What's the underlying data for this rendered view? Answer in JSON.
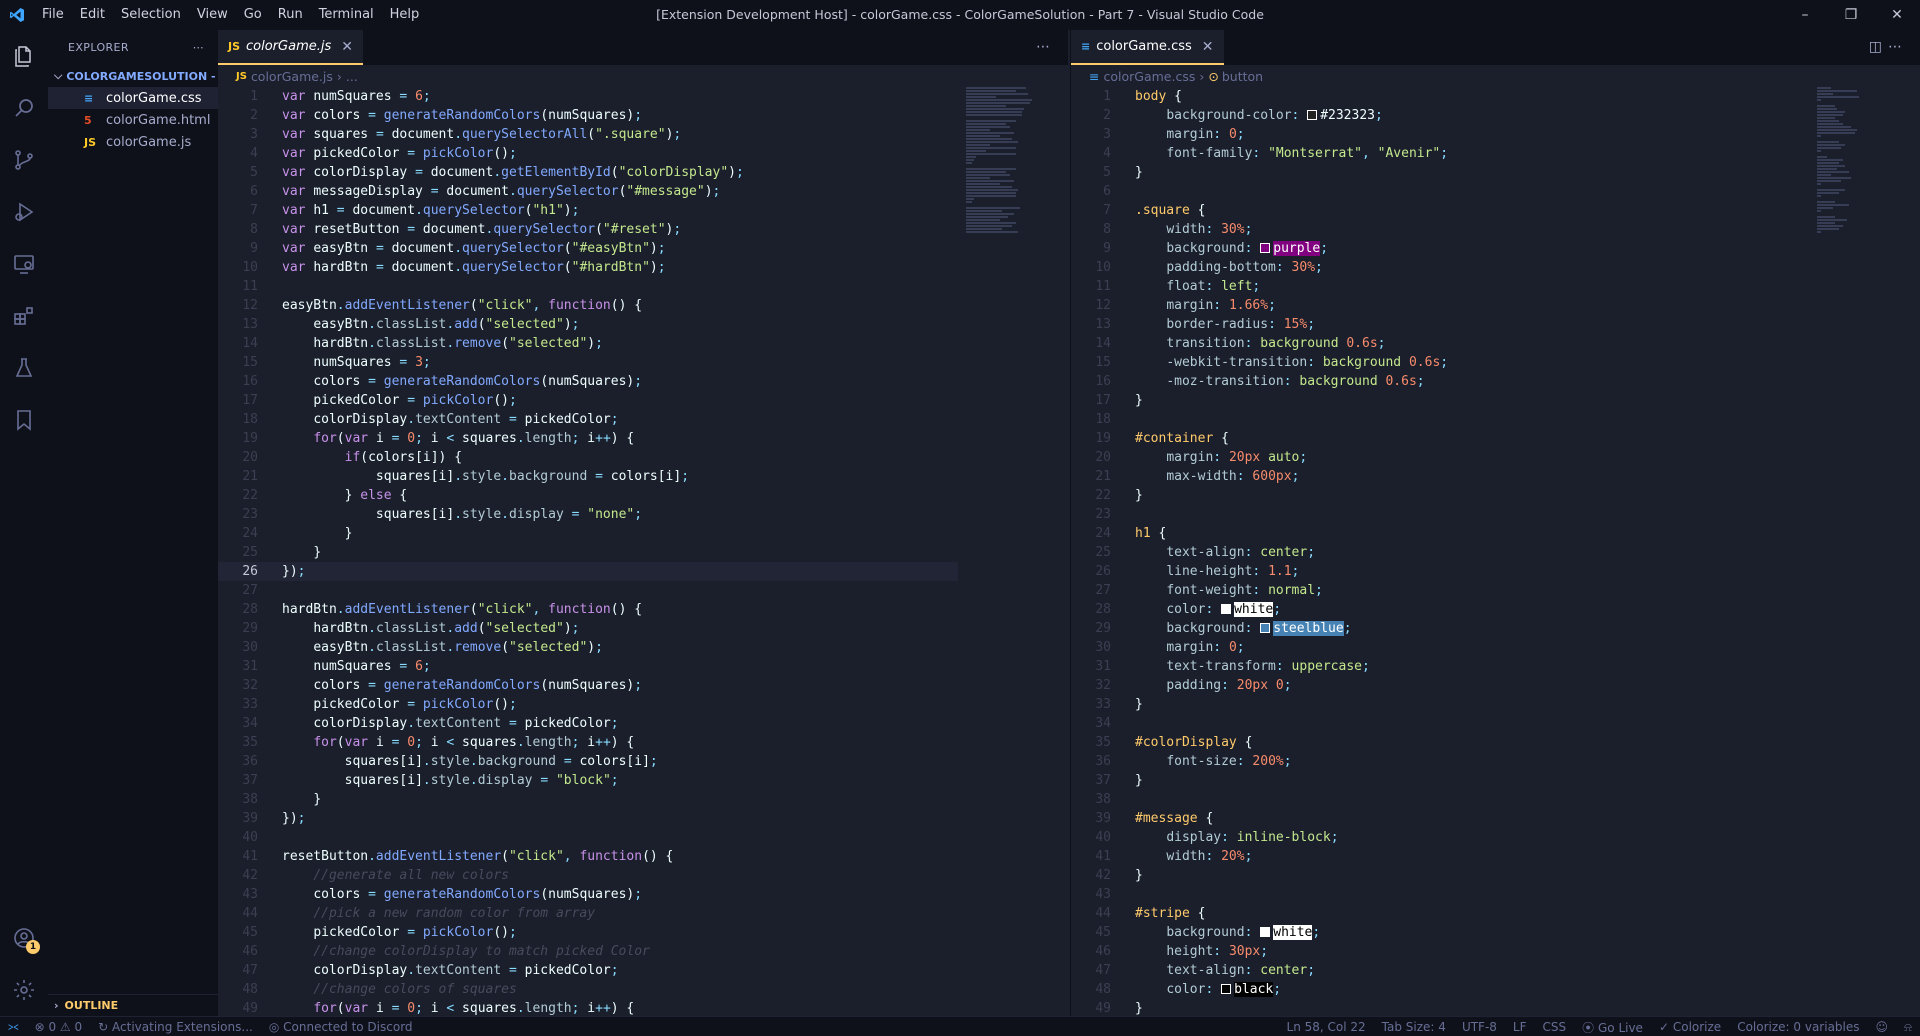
{
  "window": {
    "title": "[Extension Development Host] - colorGame.css - ColorGameSolution - Part 7 - Visual Studio Code",
    "menu": [
      "File",
      "Edit",
      "Selection",
      "View",
      "Go",
      "Run",
      "Terminal",
      "Help"
    ]
  },
  "sidebar": {
    "title": "EXPLORER",
    "folder": "COLORGAMESOLUTION - P...",
    "files": [
      {
        "name": "colorGame.css",
        "icon": "css-file-icon"
      },
      {
        "name": "colorGame.html",
        "icon": "html-file-icon"
      },
      {
        "name": "colorGame.js",
        "icon": "js-file-icon"
      }
    ],
    "outline": "OUTLINE"
  },
  "left_editor": {
    "tab": "colorGame.js",
    "breadcrumb": [
      "colorGame.js",
      "..."
    ],
    "current_line": 26
  },
  "right_editor": {
    "tab": "colorGame.css",
    "breadcrumb": [
      "colorGame.css",
      "button"
    ]
  },
  "statusbar": {
    "errors": "0",
    "warnings": "0",
    "activity": "Activating Extensions...",
    "discord": "Connected to Discord",
    "position": "Ln 58, Col 22",
    "tab_size": "Tab Size: 4",
    "encoding": "UTF-8",
    "eol": "LF",
    "language": "CSS",
    "live": "Go Live",
    "colorize": "Colorize",
    "colorize_vars": "Colorize: 0 variables",
    "notification_badge": "1"
  },
  "colors": {
    "accent": "#ffcb6b",
    "background": "#1b1e2b",
    "panel": "#0f111a"
  }
}
